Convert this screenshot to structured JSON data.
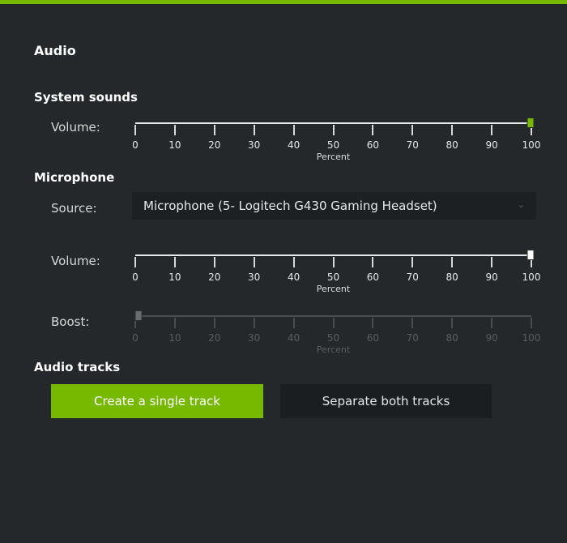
{
  "colors": {
    "accent": "#76b900",
    "background": "#25282a",
    "control_bg": "#1d2022"
  },
  "audio": {
    "title": "Audio"
  },
  "system_sounds": {
    "title": "System sounds",
    "volume": {
      "label": "Volume:",
      "value_percent": 100,
      "unit": "Percent"
    }
  },
  "microphone": {
    "title": "Microphone",
    "source": {
      "label": "Source:",
      "value": "Microphone (5- Logitech G430 Gaming Headset)",
      "icon": "chevron-down-icon"
    },
    "volume": {
      "label": "Volume:",
      "value_percent": 100,
      "unit": "Percent"
    },
    "boost": {
      "label": "Boost:",
      "value_percent": 0,
      "unit": "Percent",
      "disabled": true
    }
  },
  "slider_ticks": [
    "0",
    "10",
    "20",
    "30",
    "40",
    "50",
    "60",
    "70",
    "80",
    "90",
    "100"
  ],
  "audio_tracks": {
    "title": "Audio tracks",
    "create_single_label": "Create a single track",
    "separate_both_label": "Separate both tracks",
    "selected": "create_single"
  }
}
